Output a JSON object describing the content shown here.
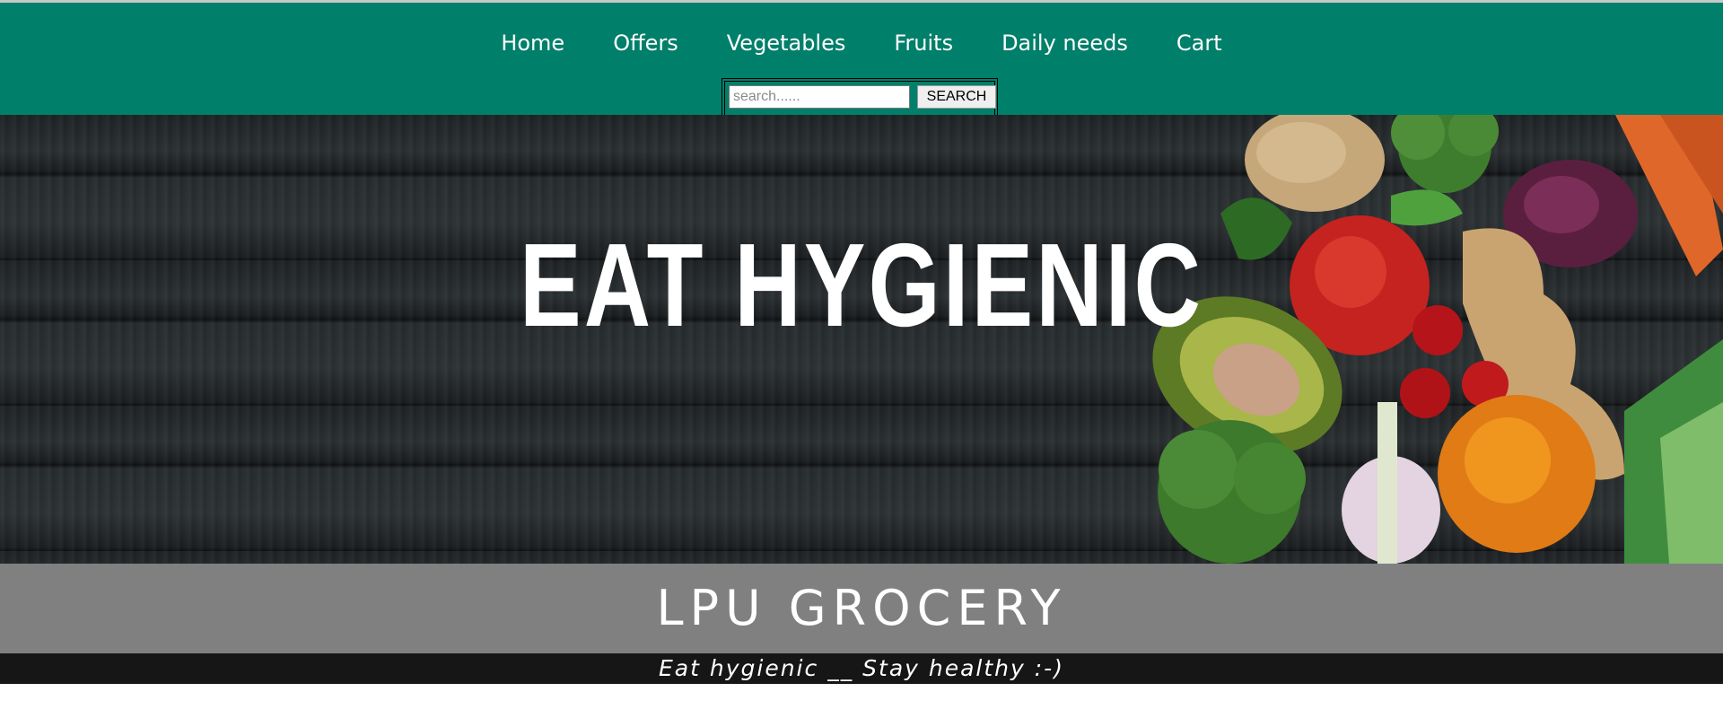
{
  "nav": {
    "items": [
      {
        "label": "Home"
      },
      {
        "label": "Offers"
      },
      {
        "label": "Vegetables"
      },
      {
        "label": "Fruits"
      },
      {
        "label": "Daily needs"
      },
      {
        "label": "Cart"
      }
    ]
  },
  "search": {
    "placeholder": "search......",
    "value": "",
    "button_label": "SEARCH"
  },
  "hero": {
    "title": "EAT HYGIENIC",
    "image_icon": "vegetables-image"
  },
  "brand": {
    "title": "LPU GROCERY"
  },
  "tagline": {
    "text": "Eat hygienic __ Stay healthy :-)"
  },
  "colors": {
    "header_bg": "#007f6a",
    "brand_bar_bg": "#808080",
    "tag_bar_bg": "#161616"
  }
}
